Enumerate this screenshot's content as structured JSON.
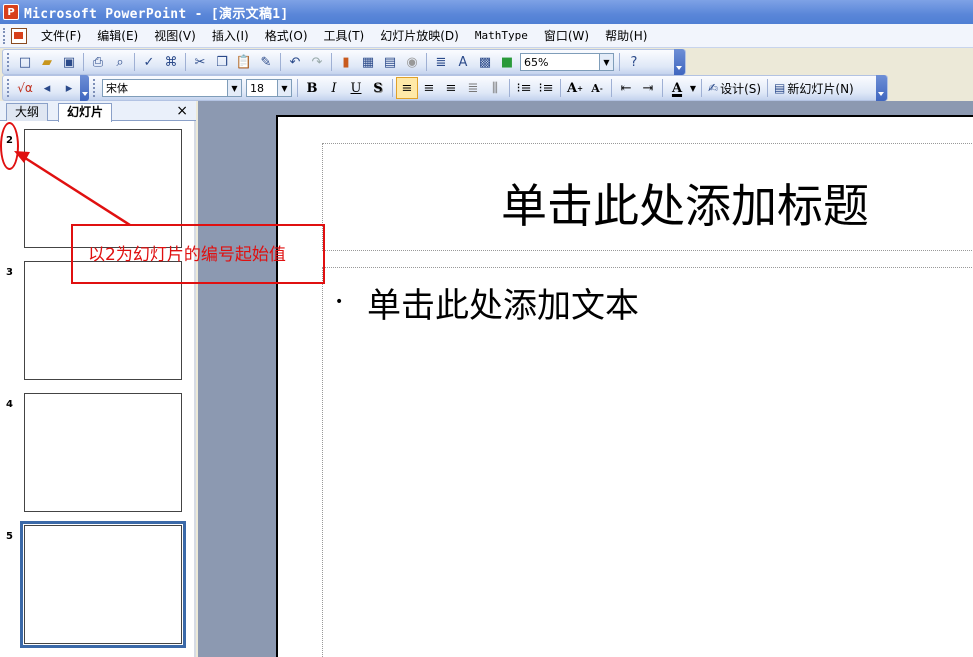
{
  "window": {
    "title": "Microsoft PowerPoint - [演示文稿1]",
    "app_icon_text": "P"
  },
  "menu": [
    {
      "label": "文件(F)"
    },
    {
      "label": "编辑(E)"
    },
    {
      "label": "视图(V)"
    },
    {
      "label": "插入(I)"
    },
    {
      "label": "格式(O)"
    },
    {
      "label": "工具(T)"
    },
    {
      "label": "幻灯片放映(D)"
    },
    {
      "label": "MathType"
    },
    {
      "label": "窗口(W)"
    },
    {
      "label": "帮助(H)"
    }
  ],
  "standard_toolbar": {
    "zoom": "65%"
  },
  "format_toolbar": {
    "font": "宋体",
    "size": "18",
    "bold": "B",
    "italic": "I",
    "underline": "U",
    "shadow": "S",
    "font_color": "A",
    "design_label": "设计(S)",
    "new_slide_label": "新幻灯片(N)"
  },
  "left_pane": {
    "tabs": [
      {
        "label": "大纲"
      },
      {
        "label": "幻灯片"
      }
    ],
    "close": "×",
    "slides": [
      {
        "number": "2"
      },
      {
        "number": "3"
      },
      {
        "number": "4"
      },
      {
        "number": "5"
      }
    ]
  },
  "slide": {
    "title_placeholder": "单击此处添加标题",
    "body_placeholder": "单击此处添加文本",
    "bullet": "•"
  },
  "annotation": {
    "text": "以2为幻灯片的编号起始值",
    "color": "#e01010"
  },
  "colors": {
    "title_bar": "#5a86d8",
    "selected_thumb": "#3b69a8",
    "workspace": "#8c99b1"
  }
}
